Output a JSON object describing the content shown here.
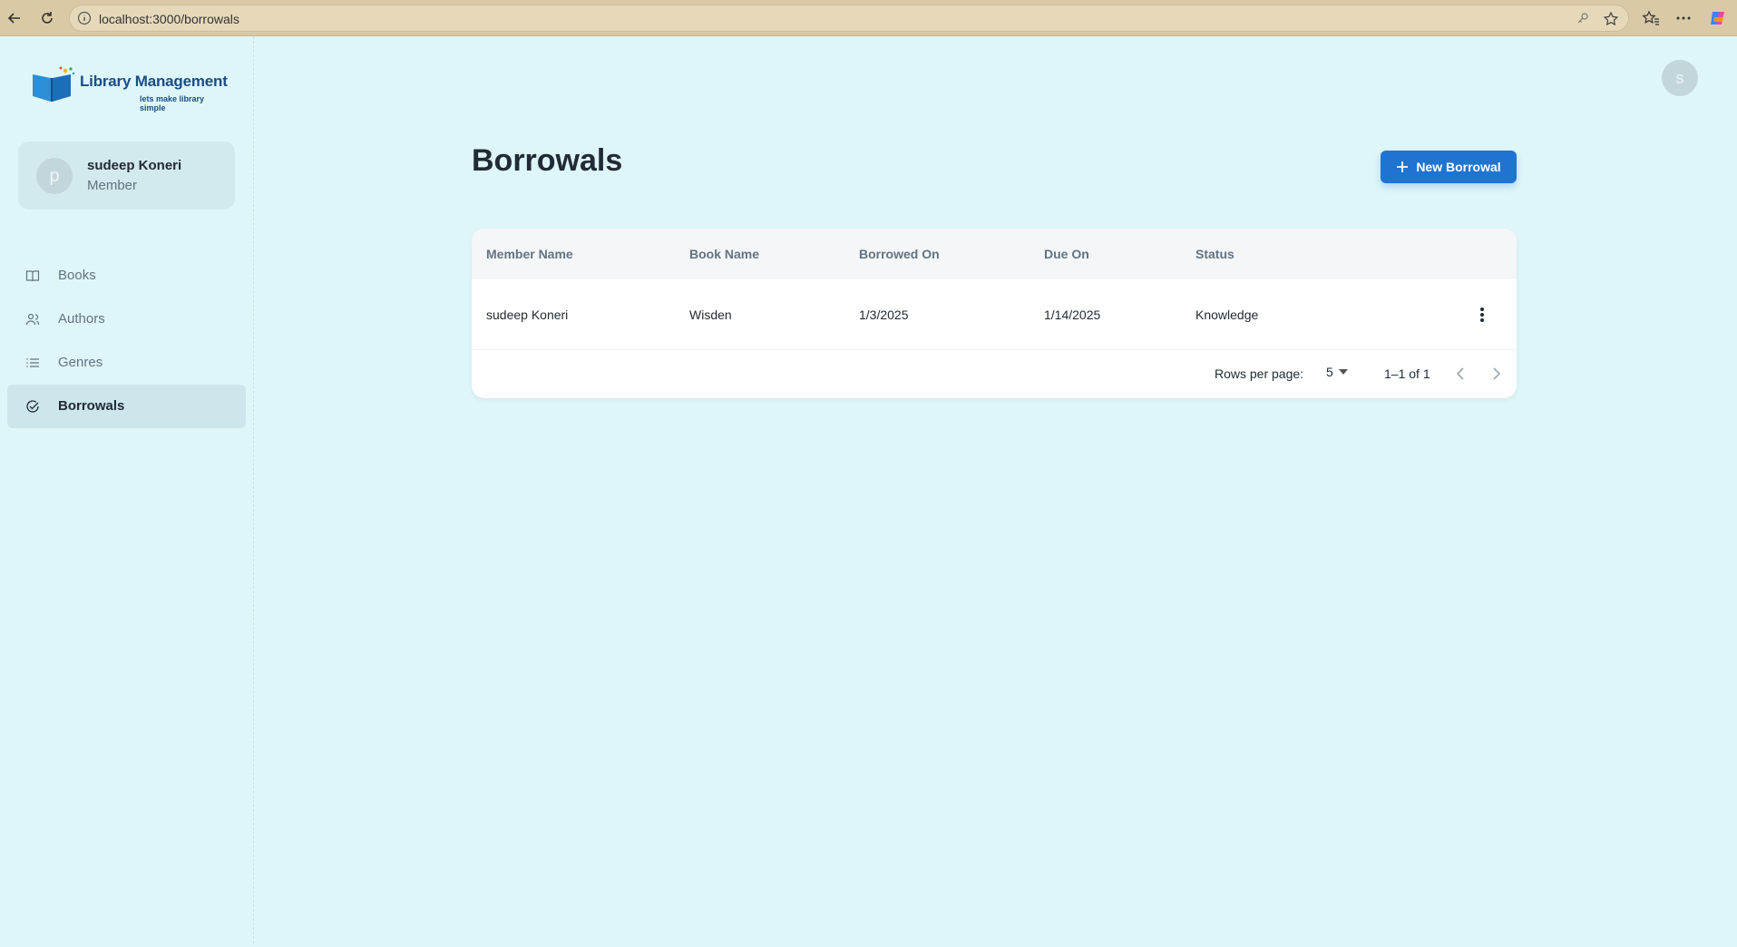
{
  "browser": {
    "url": "localhost:3000/borrowals"
  },
  "sidebar": {
    "logo": {
      "title": "Library Management",
      "subtitle": "lets make library simple"
    },
    "account": {
      "avatar_letter": "p",
      "name": "sudeep Koneri",
      "role": "Member"
    },
    "items": [
      {
        "label": "Books",
        "icon": "book-icon",
        "active": false
      },
      {
        "label": "Authors",
        "icon": "users-icon",
        "active": false
      },
      {
        "label": "Genres",
        "icon": "list-icon",
        "active": false
      },
      {
        "label": "Borrowals",
        "icon": "check-circle-icon",
        "active": true
      }
    ]
  },
  "header": {
    "avatar_letter": "s"
  },
  "main": {
    "title": "Borrowals",
    "new_button_label": "New Borrowal",
    "table": {
      "columns": [
        "Member Name",
        "Book Name",
        "Borrowed On",
        "Due On",
        "Status"
      ],
      "rows": [
        [
          "sudeep Koneri",
          "Wisden",
          "1/3/2025",
          "1/14/2025",
          "Knowledge"
        ]
      ]
    },
    "pagination": {
      "rows_per_page_label": "Rows per page:",
      "rows_per_page_value": "5",
      "range": "1–1 of 1"
    }
  },
  "colors": {
    "background": "#dff6f9",
    "primary": "#1f74d1",
    "logo_blue": "#1a4d86"
  }
}
